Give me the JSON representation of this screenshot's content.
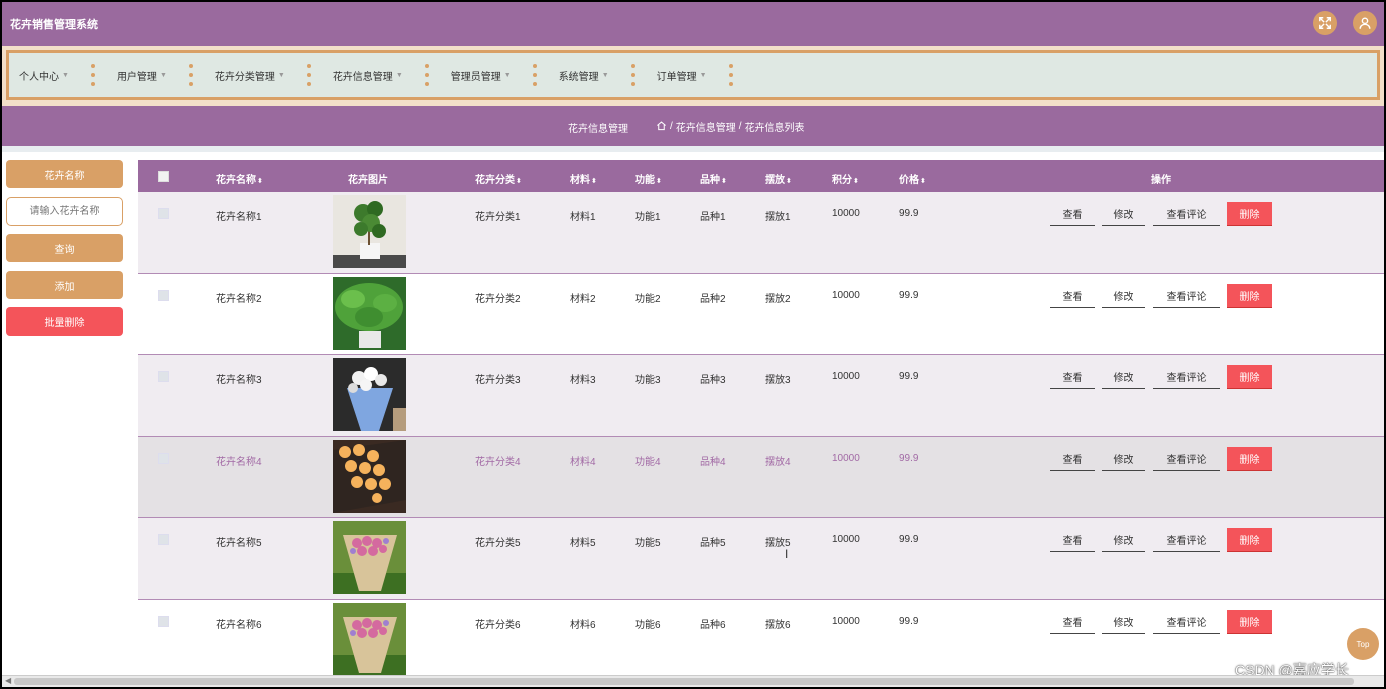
{
  "app": {
    "title": "花卉销售管理系统"
  },
  "header": {
    "fullscreen_icon": "expand-icon",
    "user_icon": "user-icon"
  },
  "nav": {
    "items": [
      {
        "label": "个人中心"
      },
      {
        "label": "用户管理"
      },
      {
        "label": "花卉分类管理"
      },
      {
        "label": "花卉信息管理"
      },
      {
        "label": "管理员管理"
      },
      {
        "label": "系统管理"
      },
      {
        "label": "订单管理"
      }
    ],
    "caret": "▼"
  },
  "breadcrumb": {
    "page_title": "花卉信息管理",
    "sep": "/",
    "path": [
      "花卉信息管理",
      "花卉信息列表"
    ]
  },
  "search": {
    "label": "花卉名称",
    "placeholder": "请输入花卉名称",
    "query_label": "查询",
    "add_label": "添加",
    "batch_delete_label": "批量删除"
  },
  "table": {
    "columns": [
      "花卉名称",
      "花卉图片",
      "花卉分类",
      "材料",
      "功能",
      "品种",
      "摆放",
      "积分",
      "价格",
      "操作"
    ],
    "sort_glyph": "⬍",
    "actions": {
      "view": "查看",
      "edit": "修改",
      "comments": "查看评论",
      "delete": "删除"
    },
    "rows": [
      {
        "name": "花卉名称1",
        "category": "花卉分类1",
        "material": "材料1",
        "function": "功能1",
        "variety": "品种1",
        "placement": "摆放1",
        "points": "10000",
        "price": "99.9"
      },
      {
        "name": "花卉名称2",
        "category": "花卉分类2",
        "material": "材料2",
        "function": "功能2",
        "variety": "品种2",
        "placement": "摆放2",
        "points": "10000",
        "price": "99.9"
      },
      {
        "name": "花卉名称3",
        "category": "花卉分类3",
        "material": "材料3",
        "function": "功能3",
        "variety": "品种3",
        "placement": "摆放3",
        "points": "10000",
        "price": "99.9"
      },
      {
        "name": "花卉名称4",
        "category": "花卉分类4",
        "material": "材料4",
        "function": "功能4",
        "variety": "品种4",
        "placement": "摆放4",
        "points": "10000",
        "price": "99.9"
      },
      {
        "name": "花卉名称5",
        "category": "花卉分类5",
        "material": "材料5",
        "function": "功能5",
        "variety": "品种5",
        "placement": "摆放5",
        "points": "10000",
        "price": "99.9"
      },
      {
        "name": "花卉名称6",
        "category": "花卉分类6",
        "material": "材料6",
        "function": "功能6",
        "variety": "品种6",
        "placement": "摆放6",
        "points": "10000",
        "price": "99.9"
      }
    ]
  },
  "back_to_top": "Top",
  "watermark": "CSDN @嘉应学长",
  "colors": {
    "primary": "#9a6a9e",
    "accent": "#d9a066",
    "danger": "#f4545a",
    "nav_bg": "#dfe8e3"
  }
}
